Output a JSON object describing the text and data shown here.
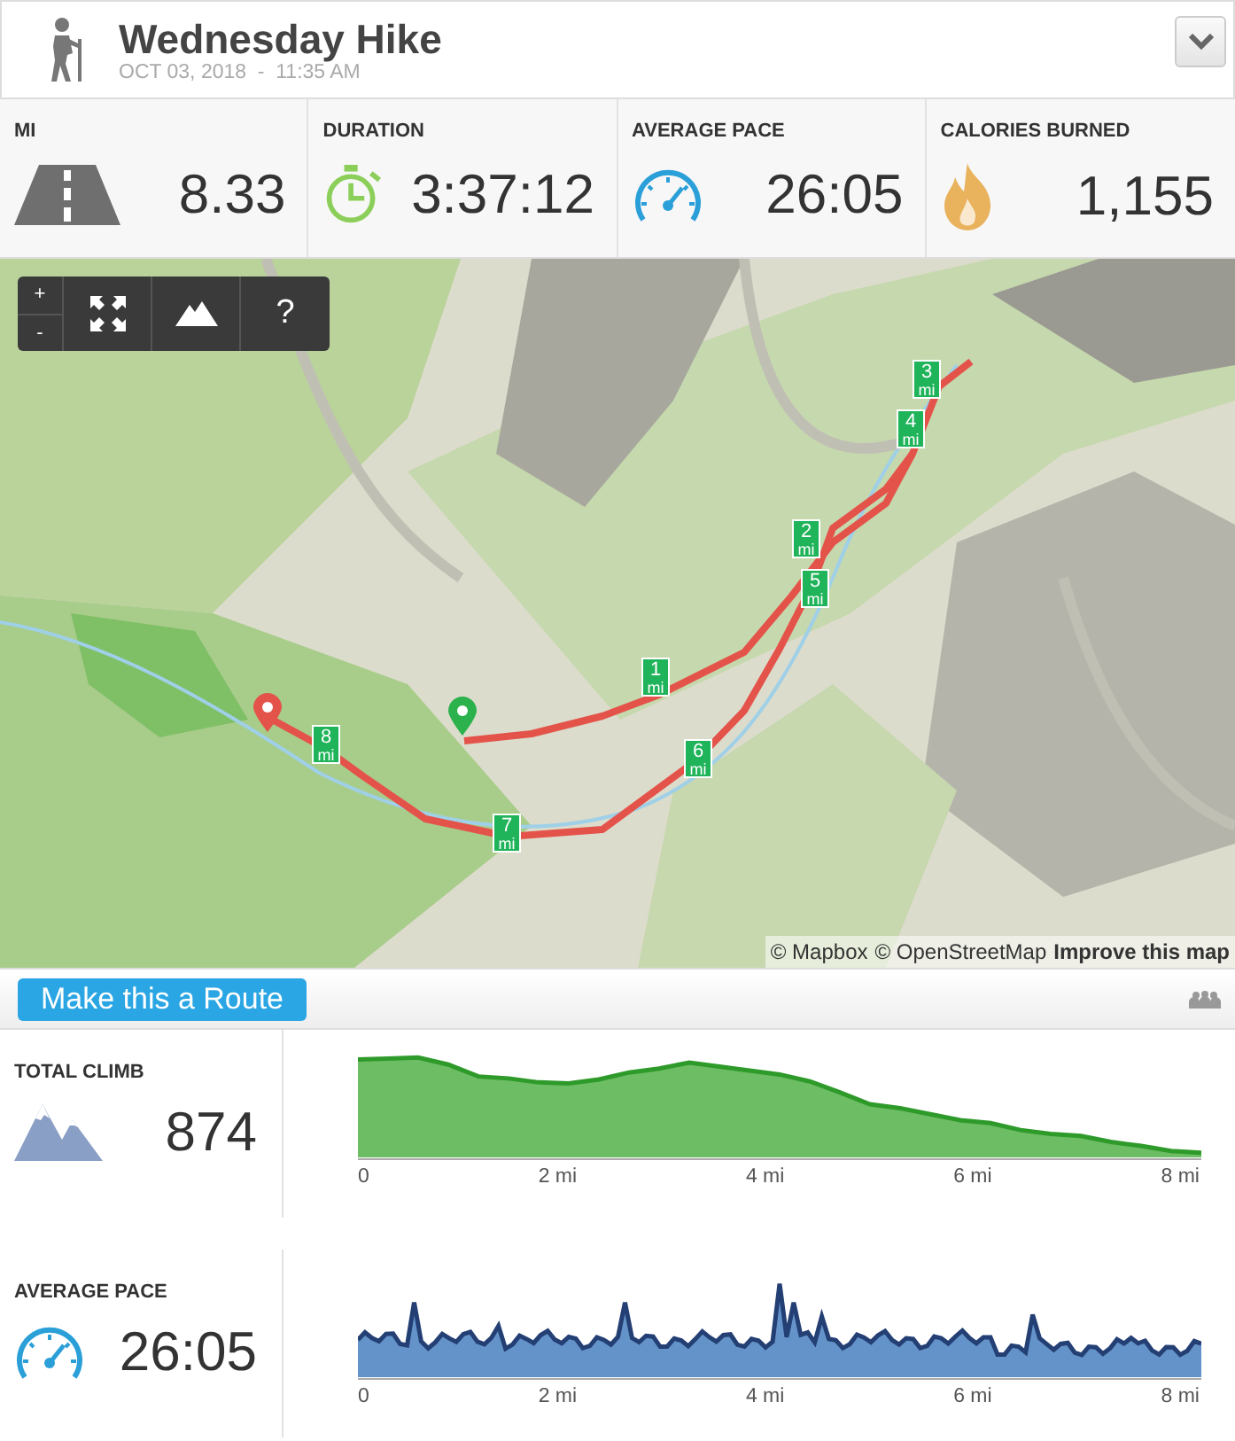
{
  "header": {
    "title": "Wednesday Hike",
    "datetime": "OCT 03, 2018  -  11:35 AM"
  },
  "stats": [
    {
      "kind": "road",
      "label": "MI",
      "value": "8.33"
    },
    {
      "kind": "stopwatch",
      "label": "DURATION",
      "value": "3:37:12"
    },
    {
      "kind": "gauge",
      "label": "AVERAGE PACE",
      "value": "26:05"
    },
    {
      "kind": "flame",
      "label": "CALORIES BURNED",
      "value": "1,155"
    }
  ],
  "map": {
    "controls": {
      "zoom_in": "+",
      "zoom_out": "-",
      "help": "?"
    },
    "markers": [
      {
        "label": "1",
        "unit": "mi"
      },
      {
        "label": "2",
        "unit": "mi"
      },
      {
        "label": "3",
        "unit": "mi"
      },
      {
        "label": "4",
        "unit": "mi"
      },
      {
        "label": "5",
        "unit": "mi"
      },
      {
        "label": "6",
        "unit": "mi"
      },
      {
        "label": "7",
        "unit": "mi"
      },
      {
        "label": "8",
        "unit": "mi"
      }
    ],
    "attribution": {
      "mapbox": "© Mapbox",
      "osm": "© OpenStreetMap",
      "improve": "Improve this map"
    }
  },
  "route_bar": {
    "button": "Make this a Route"
  },
  "sections": [
    {
      "kind": "mountains",
      "label": "TOTAL CLIMB",
      "value": "874",
      "xticks": [
        "0",
        "2 mi",
        "4 mi",
        "6 mi",
        "8 mi"
      ]
    },
    {
      "kind": "gauge",
      "label": "AVERAGE PACE",
      "value": "26:05",
      "xticks": [
        "0",
        "2 mi",
        "4 mi",
        "6 mi",
        "8 mi"
      ]
    }
  ]
}
